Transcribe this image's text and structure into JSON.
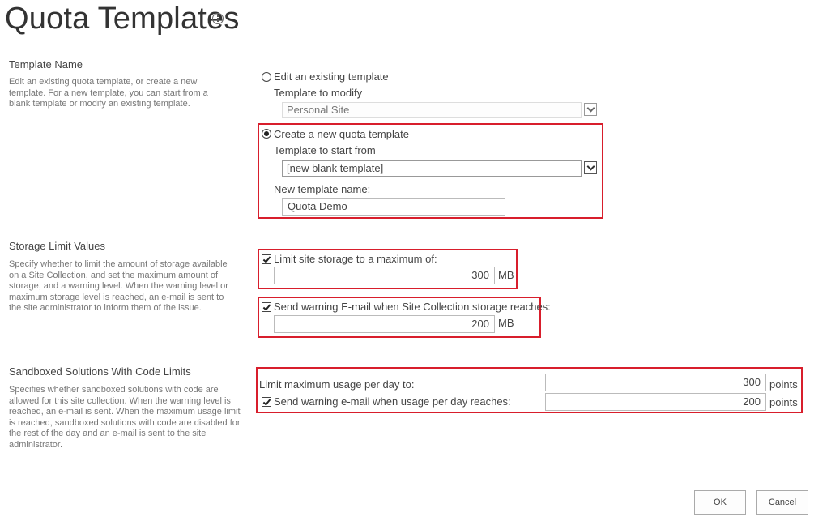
{
  "page": {
    "title": "Quota Templates",
    "info_icon": "info-icon"
  },
  "template_name": {
    "title": "Template Name",
    "description": "Edit an existing quota template, or create a new template. For a new template, you can start from a blank template or modify an existing template.",
    "edit_existing": {
      "label": "Edit an existing template",
      "selected": false
    },
    "template_to_modify_label": "Template to modify",
    "template_to_modify_value": "Personal Site",
    "create_new": {
      "label": "Create a new quota template",
      "selected": true
    },
    "template_to_start_label": "Template to start from",
    "template_to_start_value": "[new blank template]",
    "new_name_label": "New template name:",
    "new_name_value": "Quota Demo"
  },
  "storage": {
    "title": "Storage Limit Values",
    "description": "Specify whether to limit the amount of storage available on a Site Collection, and set the maximum amount of storage, and a warning level. When the warning level or maximum storage level is reached, an e-mail is sent to the site administrator to inform them of the issue.",
    "limit_label": "Limit site storage to a maximum of:",
    "limit_checked": true,
    "limit_value": "300",
    "limit_unit": "MB",
    "warning_label": "Send warning E-mail when Site Collection storage reaches:",
    "warning_checked": true,
    "warning_value": "200",
    "warning_unit": "MB"
  },
  "sandbox": {
    "title": "Sandboxed Solutions With Code Limits",
    "description": "Specifies whether sandboxed solutions with code are allowed for this site collection.  When the warning level is reached, an e-mail is sent.  When the maximum usage limit is reached, sandboxed solutions with code are disabled for the rest of the day and an e-mail is sent to the site administrator.",
    "max_label": "Limit maximum usage per day to:",
    "max_value": "300",
    "max_unit": "points",
    "warning_label": "Send warning e-mail when usage per day reaches:",
    "warning_checked": true,
    "warning_value": "200",
    "warning_unit": "points"
  },
  "buttons": {
    "ok": "OK",
    "cancel": "Cancel"
  },
  "colors": {
    "highlight": "#d81e2c",
    "text": "#444444",
    "muted": "#777777"
  }
}
